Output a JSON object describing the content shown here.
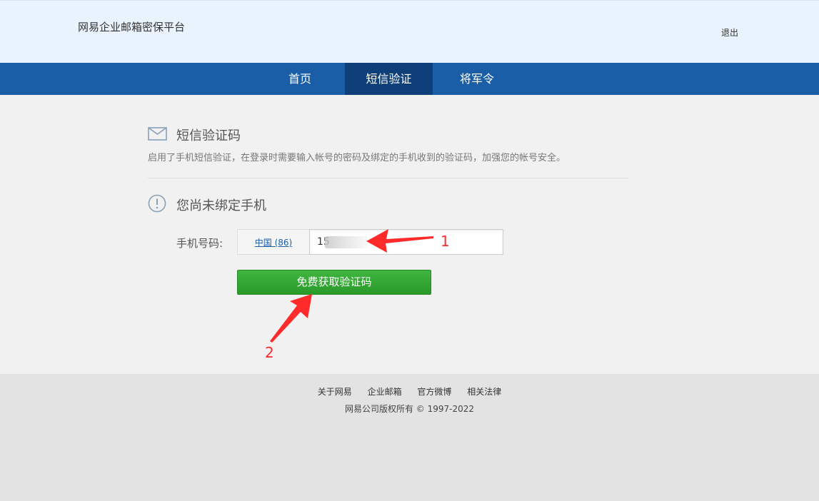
{
  "header": {
    "brand": "网易企业邮箱密保平台",
    "logout_label": "退出"
  },
  "nav": {
    "items": [
      {
        "label": "首页",
        "active": false
      },
      {
        "label": "短信验证",
        "active": true
      },
      {
        "label": "将军令",
        "active": false
      }
    ]
  },
  "sms_section": {
    "icon": "mail-icon",
    "title": "短信验证码",
    "description": "启用了手机短信验证，在登录时需要输入帐号的密码及绑定的手机收到的验证码，加强您的帐号安全。"
  },
  "status": {
    "icon": "warning-circle-icon",
    "text": "您尚未绑定手机"
  },
  "form": {
    "phone_label": "手机号码:",
    "country_code": "中国 (86)",
    "phone_value": "15",
    "submit_label": "免费获取验证码"
  },
  "annotations": {
    "label_1": "1",
    "label_2": "2",
    "color": "#ff2a2a"
  },
  "footer": {
    "links": [
      "关于网易",
      "企业邮箱",
      "官方微博",
      "相关法律"
    ],
    "copyright": "网易公司版权所有 © 1997-2022"
  },
  "colors": {
    "nav_bg": "#1a5ea8",
    "nav_active_bg": "#0e3f78",
    "header_bg": "#e9f3fd",
    "button_green": "#2fa52f"
  }
}
